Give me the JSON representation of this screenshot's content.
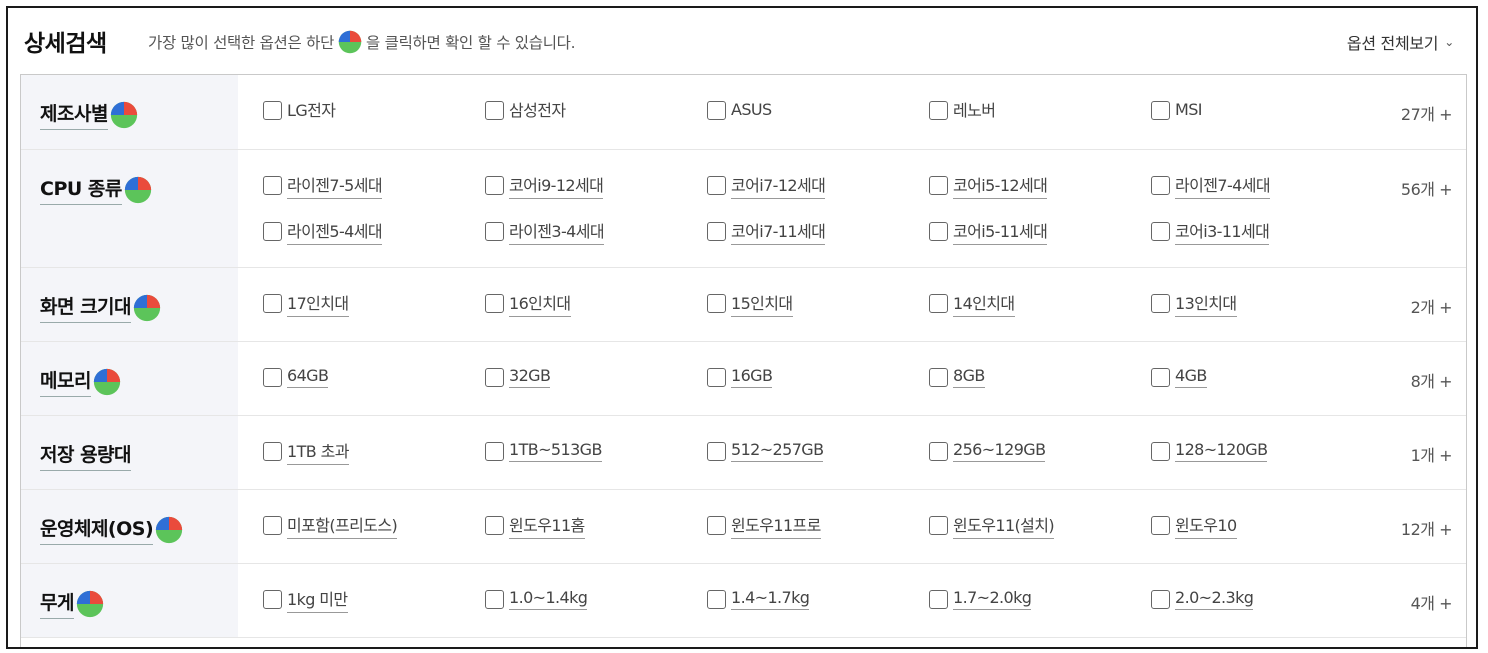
{
  "header": {
    "title": "상세검색",
    "description_before": "가장 많이 선택한 옵션은 하단",
    "description_after": "을 클릭하면 확인 할 수 있습니다.",
    "view_all_label": "옵션 전체보기"
  },
  "colors": {
    "pie_red": "#ea4b3c",
    "pie_blue": "#2f6fd6",
    "pie_green": "#5cc45a",
    "label_bg": "#f4f5f9"
  },
  "rows": [
    {
      "label": "제조사별",
      "has_pie": true,
      "underline": false,
      "more": "27개 +",
      "options": [
        "LG전자",
        "삼성전자",
        "ASUS",
        "레노버",
        "MSI"
      ]
    },
    {
      "label": "CPU 종류",
      "has_pie": true,
      "underline": true,
      "more": "56개 +",
      "options": [
        "라이젠7-5세대",
        "코어i9-12세대",
        "코어i7-12세대",
        "코어i5-12세대",
        "라이젠7-4세대",
        "라이젠5-4세대",
        "라이젠3-4세대",
        "코어i7-11세대",
        "코어i5-11세대",
        "코어i3-11세대"
      ]
    },
    {
      "label": "화면 크기대",
      "has_pie": true,
      "underline": true,
      "more": "2개 +",
      "options": [
        "17인치대",
        "16인치대",
        "15인치대",
        "14인치대",
        "13인치대"
      ]
    },
    {
      "label": "메모리",
      "has_pie": true,
      "underline": true,
      "more": "8개 +",
      "options": [
        "64GB",
        "32GB",
        "16GB",
        "8GB",
        "4GB"
      ]
    },
    {
      "label": "저장 용량대",
      "has_pie": false,
      "underline": true,
      "more": "1개 +",
      "options": [
        "1TB 초과",
        "1TB~513GB",
        "512~257GB",
        "256~129GB",
        "128~120GB"
      ]
    },
    {
      "label": "운영체제(OS)",
      "has_pie": true,
      "underline": true,
      "more": "12개 +",
      "options": [
        "미포함(프리도스)",
        "윈도우11홈",
        "윈도우11프로",
        "윈도우11(설치)",
        "윈도우10"
      ]
    },
    {
      "label": "무게",
      "has_pie": true,
      "underline": true,
      "more": "4개 +",
      "options": [
        "1kg 미만",
        "1.0~1.4kg",
        "1.4~1.7kg",
        "1.7~2.0kg",
        "2.0~2.3kg"
      ]
    }
  ]
}
